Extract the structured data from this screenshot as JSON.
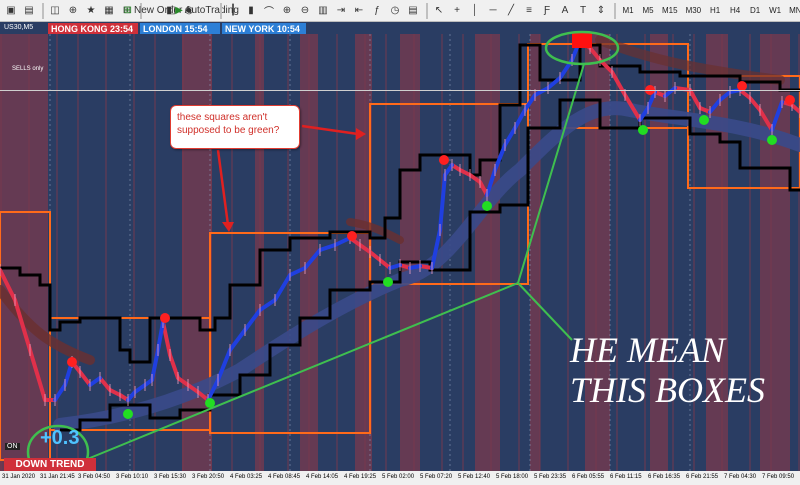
{
  "toolbar": {
    "new_order": "New Order",
    "autotrading": "AutoTrading",
    "timeframes": [
      "M1",
      "M5",
      "M15",
      "M30",
      "H1",
      "H4",
      "D1",
      "W1",
      "MN"
    ]
  },
  "chart": {
    "symbol": "US30,M5",
    "sessions": [
      {
        "name": "HONG KONG",
        "time": "23:54",
        "color": "#d0303a"
      },
      {
        "name": "LONDON",
        "time": "15:54",
        "color": "#2c7fd6"
      },
      {
        "name": "NEW YORK",
        "time": "10:54",
        "color": "#2c7fd6"
      }
    ],
    "sells_label": "SELLS only",
    "trend_label": "DOWN TREND",
    "value_label": "+0.3",
    "on_label": "ON",
    "note": "these squares aren't supposed to be green?",
    "annotation_line1": "HE MEAN",
    "annotation_line2": "THIS BOXES",
    "x_labels": [
      "31 Jan 2020",
      "31 Jan 21:45",
      "3 Feb 04:50",
      "3 Feb 10:10",
      "3 Feb 15:30",
      "3 Feb 20:50",
      "4 Feb 03:25",
      "4 Feb 08:45",
      "4 Feb 14:05",
      "4 Feb 19:25",
      "5 Feb 02:00",
      "5 Feb 07:20",
      "5 Feb 12:40",
      "5 Feb 18:00",
      "5 Feb 23:35",
      "6 Feb 05:55",
      "6 Feb 11:15",
      "6 Feb 16:35",
      "6 Feb 21:55",
      "7 Feb 04:30",
      "7 Feb 09:50"
    ],
    "colors": {
      "bg": "#2a3d63",
      "stripe": "#7a3a4e",
      "box": "#ff6a1a",
      "step": "#000000",
      "up": "#1f3fe0",
      "down": "#e0304a",
      "band": "#3a4a8a",
      "dot_red": "#ff2020",
      "dot_green": "#22dd22",
      "circle": "#3fbf4f"
    }
  }
}
